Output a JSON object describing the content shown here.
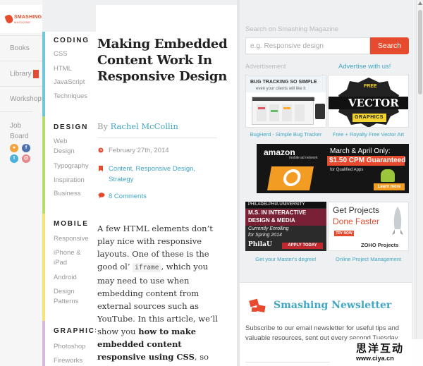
{
  "logo": {
    "text": "SMASHING",
    "sub": "MAGAZINE"
  },
  "leftnav": {
    "items": [
      {
        "label": "Books"
      },
      {
        "label": "Library"
      },
      {
        "label": "Workshops"
      },
      {
        "label": "Job Board"
      }
    ],
    "social": [
      {
        "icon": "rss-icon",
        "color": "#f3a33a",
        "glyph": "●"
      },
      {
        "icon": "facebook-icon",
        "color": "#4c71b1",
        "glyph": "f"
      },
      {
        "icon": "twitter-icon",
        "color": "#4cb0de",
        "glyph": "t"
      },
      {
        "icon": "email-icon",
        "color": "#e8878a",
        "glyph": "@"
      }
    ]
  },
  "categories": [
    {
      "heading": "CODING",
      "color": "#6fc8d9",
      "links": [
        "CSS",
        "HTML",
        "JavaScript",
        "Techniques"
      ]
    },
    {
      "heading": "DESIGN",
      "color": "#b6dc6b",
      "links": [
        "Web Design",
        "Typography",
        "Inspiration",
        "Business"
      ]
    },
    {
      "heading": "MOBILE",
      "color": "#f6e27a",
      "links": [
        "Responsive",
        "iPhone & iPad",
        "Android",
        "Design Patterns"
      ]
    },
    {
      "heading": "GRAPHICS",
      "color": "#d9b8e0",
      "links": [
        "Photoshop",
        "Fireworks"
      ]
    }
  ],
  "article": {
    "title": "Making Embedded Content Work In Responsive Design",
    "by": "By",
    "author": "Rachel McCollin",
    "date": "February 27th, 2014",
    "tags": "Content, Responsive Design, Strategy",
    "comments": "8 Comments",
    "body": {
      "p1": "A few HTML elements don’t play nice with responsive layouts. One of these is the good ol’",
      "code": "iframe",
      "p2": ", which you may need to use when embedding content from external sources such as YouTube. In this article, we’ll show you",
      "bold": "how to make embedded content responsive using CSS",
      "p3": ", so that content such as video"
    }
  },
  "sidebar": {
    "search_label": "Search on Smashing Magazine",
    "search_placeholder": "e.g. Responsive design",
    "search_button": "Search",
    "ad_label": "Advertisement",
    "ad_with_us": "Advertise with us!",
    "ads": {
      "bugherd": {
        "caption": "BugHerd - Simple Bug Tracker",
        "line1": "BUG TRACKING SO SIMPLE",
        "line2": "even your clients will like it"
      },
      "vector": {
        "caption": "Free + Royalty Free Vector Art",
        "line1": "FREE",
        "line2": "VECTOR",
        "line3": "GRAPHICS"
      },
      "amazon": {
        "brand": "amazon",
        "network": "mobile ad network",
        "line1": "March & April Only:",
        "line2": "$1.50 CPM Guaranteed",
        "line3": "for Qualified Apps",
        "cta": "Learn more"
      },
      "philau": {
        "caption": "Get your Master's degree!",
        "line1": "PHILADELPHIA UNIVERSITY",
        "line2": "M.S. IN INTERACTIVE",
        "line3": "DESIGN & MEDIA",
        "line4": "Currently Enrolling",
        "line5": "for Spring 2014",
        "brand": "PhilaU",
        "cta": "APPLY TODAY"
      },
      "zoho": {
        "caption": "Online Project Management",
        "line1": "Get Projects",
        "line2": "Done Faster",
        "cta": "TRY NOW",
        "brand": "ZOHO Projects"
      }
    }
  },
  "newsletter": {
    "title": "Smashing Newsletter",
    "text": "Subscribe to our email newsletter for useful tips and valuable resources, sent out every second Tuesday."
  },
  "watermark": {
    "cn": "思洋互动",
    "url": "www.ciya.cn"
  },
  "colors": {
    "accent": "#41a7c5",
    "brand": "#e64b2f"
  }
}
